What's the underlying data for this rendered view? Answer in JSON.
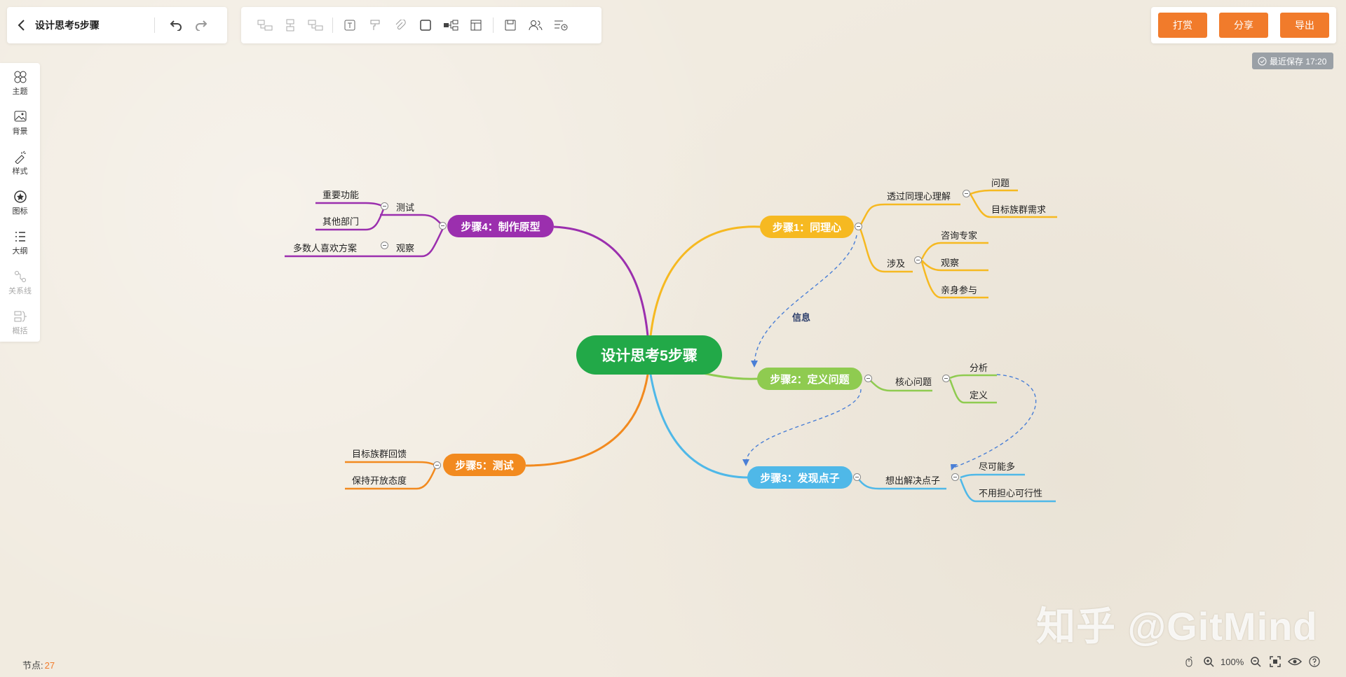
{
  "header": {
    "title": "设计思考5步骤"
  },
  "toolbar": {
    "icons": [
      "add-child-node-icon",
      "add-sibling-node-icon",
      "add-parent-node-icon",
      "text-icon",
      "format-painter-icon",
      "attachment-icon",
      "box-icon",
      "relation-icon",
      "table-icon",
      "save-icon",
      "collaborate-icon",
      "history-icon"
    ]
  },
  "actions": {
    "reward": "打赏",
    "share": "分享",
    "export": "导出"
  },
  "save_status": "最近保存 17:20",
  "sidebar": {
    "items": [
      {
        "label": "主题",
        "icon": "theme-icon"
      },
      {
        "label": "背景",
        "icon": "background-icon"
      },
      {
        "label": "样式",
        "icon": "style-icon"
      },
      {
        "label": "图标",
        "icon": "sticker-icon"
      },
      {
        "label": "大纲",
        "icon": "outline-icon"
      },
      {
        "label": "关系线",
        "icon": "relation-line-icon"
      },
      {
        "label": "概括",
        "icon": "summary-icon"
      }
    ]
  },
  "mindmap": {
    "root": "设计思考5步骤",
    "branches": [
      {
        "label": "步骤1：同理心",
        "color": "#f6b921",
        "children": [
          {
            "label": "透过同理心理解",
            "children": [
              "问题",
              "目标族群需求"
            ]
          },
          {
            "label": "涉及",
            "children": [
              "咨询专家",
              "观察",
              "亲身参与"
            ]
          }
        ]
      },
      {
        "label": "步骤2：定义问题",
        "color": "#8fcb50",
        "children": [
          {
            "label": "核心问题",
            "children": [
              "分析",
              "定义"
            ]
          }
        ]
      },
      {
        "label": "步骤3：发现点子",
        "color": "#4fb8e8",
        "children": [
          {
            "label": "想出解决点子",
            "children": [
              "尽可能多",
              "不用担心可行性"
            ]
          }
        ]
      },
      {
        "label": "步骤4：制作原型",
        "color": "#9b2fae",
        "children": [
          {
            "label": "测试",
            "children": [
              "重要功能",
              "其他部门"
            ]
          },
          {
            "label": "观察",
            "children": [
              "多数人喜欢方案"
            ]
          }
        ]
      },
      {
        "label": "步骤5：测试",
        "color": "#f28a1f",
        "children": [
          {
            "label": "",
            "children": [
              "目标族群回馈",
              "保持开放态度"
            ]
          }
        ]
      }
    ],
    "relation_label": "信息"
  },
  "watermark": "知乎 @GitMind",
  "footer": {
    "node_label": "节点:",
    "node_count": "27",
    "zoom": "100%"
  },
  "colors": {
    "accent": "#f17b2b",
    "root": "#22a948"
  }
}
